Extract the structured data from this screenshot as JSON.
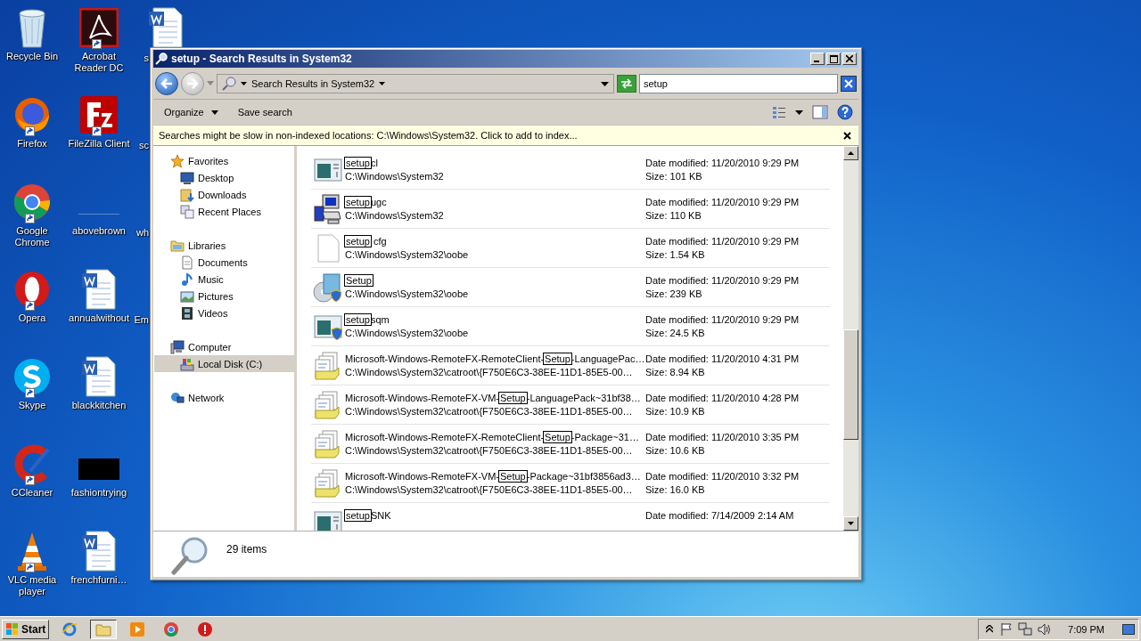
{
  "desktop": {
    "icons": [
      {
        "label": "Recycle Bin",
        "kind": "recycle",
        "shortcut": false
      },
      {
        "label": "Firefox",
        "kind": "firefox",
        "shortcut": true
      },
      {
        "label": "Google Chrome",
        "kind": "chrome",
        "shortcut": true
      },
      {
        "label": "Opera",
        "kind": "opera",
        "shortcut": true
      },
      {
        "label": "Skype",
        "kind": "skype",
        "shortcut": true
      },
      {
        "label": "CCleaner",
        "kind": "ccleaner",
        "shortcut": true
      },
      {
        "label": "VLC media player",
        "kind": "vlc",
        "shortcut": true
      },
      {
        "label": "Acrobat Reader DC",
        "kind": "acrobat",
        "shortcut": true
      },
      {
        "label": "FileZilla Client",
        "kind": "filezilla",
        "shortcut": true
      },
      {
        "label": "abovebrown",
        "kind": "blank",
        "shortcut": false
      },
      {
        "label": "annualwithout",
        "kind": "word",
        "shortcut": false
      },
      {
        "label": "blackkitchen",
        "kind": "word",
        "shortcut": false
      },
      {
        "label": "fashiontrying",
        "kind": "black",
        "shortcut": false
      },
      {
        "label": "frenchfurni…",
        "kind": "word",
        "shortcut": false
      },
      {
        "label": "s",
        "kind": "word"
      },
      {
        "label": "sc",
        "kind": "none"
      },
      {
        "label": "wh",
        "kind": "none"
      },
      {
        "label": "Em",
        "kind": "none"
      }
    ]
  },
  "window": {
    "title": "setup - Search Results in System32",
    "address": {
      "location": "Search Results in System32",
      "search_value": "setup"
    },
    "toolbar": {
      "buttons": [
        "Organize",
        "Save search"
      ]
    },
    "info_bar": "Searches might be slow in non-indexed locations: C:\\Windows\\System32. Click to add to index...",
    "sidebar": {
      "groups": [
        {
          "label": "Favorites",
          "kind": "star",
          "selected": false,
          "children": [
            {
              "label": "Desktop",
              "kind": "desktop",
              "selected": false
            },
            {
              "label": "Downloads",
              "kind": "downloads",
              "selected": false
            },
            {
              "label": "Recent Places",
              "kind": "recent",
              "selected": false
            }
          ]
        },
        {
          "label": "Libraries",
          "kind": "library",
          "selected": false,
          "children": [
            {
              "label": "Documents",
              "kind": "document",
              "selected": false
            },
            {
              "label": "Music",
              "kind": "music",
              "selected": false
            },
            {
              "label": "Pictures",
              "kind": "pictures",
              "selected": false
            },
            {
              "label": "Videos",
              "kind": "videos",
              "selected": false
            }
          ]
        },
        {
          "label": "Computer",
          "kind": "computer",
          "selected": false,
          "children": [
            {
              "label": "Local Disk (C:)",
              "kind": "disk",
              "selected": true
            }
          ]
        },
        {
          "label": "Network",
          "kind": "network",
          "selected": false
        }
      ]
    },
    "files": [
      {
        "kind": "app",
        "match": "setup",
        "name_after": "cl",
        "path": "C:\\Windows\\System32",
        "date": "Date modified: 11/20/2010 9:29 PM",
        "size": "Size: 101 KB"
      },
      {
        "kind": "installer",
        "match": "setup",
        "name_after": "ugc",
        "path": "C:\\Windows\\System32",
        "date": "Date modified: 11/20/2010 9:29 PM",
        "size": "Size: 110 KB"
      },
      {
        "kind": "blank",
        "match": "setup",
        "name_after": " cfg",
        "path": "C:\\Windows\\System32\\oobe",
        "date": "Date modified: 11/20/2010 9:29 PM",
        "size": "Size: 1.54 KB"
      },
      {
        "kind": "disc",
        "match": "Setup",
        "path": "C:\\Windows\\System32\\oobe",
        "date": "Date modified: 11/20/2010 9:29 PM",
        "size": "Size: 239 KB"
      },
      {
        "kind": "app-shield",
        "match": "setup",
        "name_after": "sqm",
        "path": "C:\\Windows\\System32\\oobe",
        "date": "Date modified: 11/20/2010 9:29 PM",
        "size": "Size: 24.5 KB"
      },
      {
        "kind": "catalog",
        "name_before": "Microsoft-Windows-RemoteFX-RemoteClient-",
        "match": "Setup",
        "name_after": "-LanguagePac…",
        "path": "C:\\Windows\\System32\\catroot\\{F750E6C3-38EE-11D1-85E5-00…",
        "date": "Date modified: 11/20/2010 4:31 PM",
        "size": "Size: 8.94 KB"
      },
      {
        "kind": "catalog",
        "name_before": "Microsoft-Windows-RemoteFX-VM-",
        "match": "Setup",
        "name_after": "-LanguagePack~31bf38…",
        "path": "C:\\Windows\\System32\\catroot\\{F750E6C3-38EE-11D1-85E5-00…",
        "date": "Date modified: 11/20/2010 4:28 PM",
        "size": "Size: 10.9 KB"
      },
      {
        "kind": "catalog",
        "name_before": "Microsoft-Windows-RemoteFX-RemoteClient-",
        "match": "Setup",
        "name_after": "-Package~31…",
        "path": "C:\\Windows\\System32\\catroot\\{F750E6C3-38EE-11D1-85E5-00…",
        "date": "Date modified: 11/20/2010 3:35 PM",
        "size": "Size: 10.6 KB"
      },
      {
        "kind": "catalog",
        "name_before": "Microsoft-Windows-RemoteFX-VM-",
        "match": "Setup",
        "name_after": "-Package~31bf3856ad3…",
        "path": "C:\\Windows\\System32\\catroot\\{F750E6C3-38EE-11D1-85E5-00…",
        "date": "Date modified: 11/20/2010 3:32 PM",
        "size": "Size: 16.0 KB"
      },
      {
        "kind": "app",
        "match": "setup",
        "name_after": "SNK",
        "date": "Date modified: 7/14/2009 2:14 AM"
      }
    ],
    "details": {
      "count": "29 items"
    }
  },
  "taskbar": {
    "start": "Start",
    "apps": [
      {
        "kind": "ie",
        "selected": false
      },
      {
        "kind": "explorer",
        "selected": true
      },
      {
        "kind": "media",
        "selected": false
      },
      {
        "kind": "chrome",
        "selected": false
      },
      {
        "kind": "opera",
        "selected": false
      }
    ],
    "clock": "7:09 PM"
  }
}
